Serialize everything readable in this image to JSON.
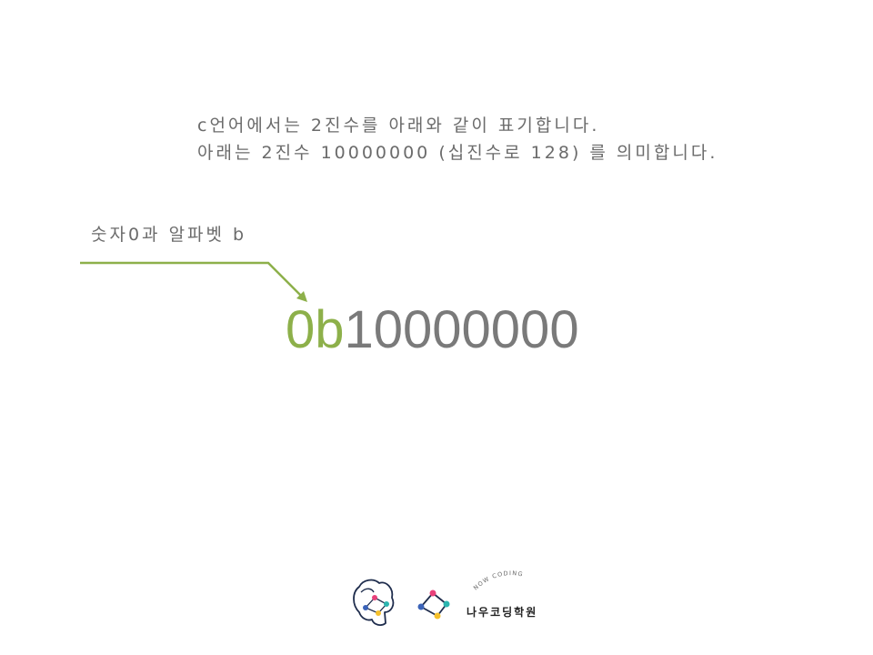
{
  "slide": {
    "line1": "c언어에서는 2진수를 아래와 같이 표기합니다.",
    "line2": "아래는 2진수 10000000 (십진수로 128) 를 의미합니다.",
    "prefix_label": "숫자0과 알파벳 b",
    "code_prefix": "0b",
    "code_digits": "10000000"
  },
  "logo": {
    "tagline": "NOW CODING",
    "name": "나우코딩학원",
    "icons": [
      "brain-network-icon",
      "network-graph-icon"
    ]
  },
  "colors": {
    "accent": "#8db04a",
    "text": "#6b6b6b",
    "code": "#7a7a7a",
    "navy": "#1f2d4d",
    "node_pink": "#e8417a",
    "node_teal": "#2bb5b0",
    "node_yellow": "#f5c02b",
    "node_blue": "#3b63b8"
  }
}
